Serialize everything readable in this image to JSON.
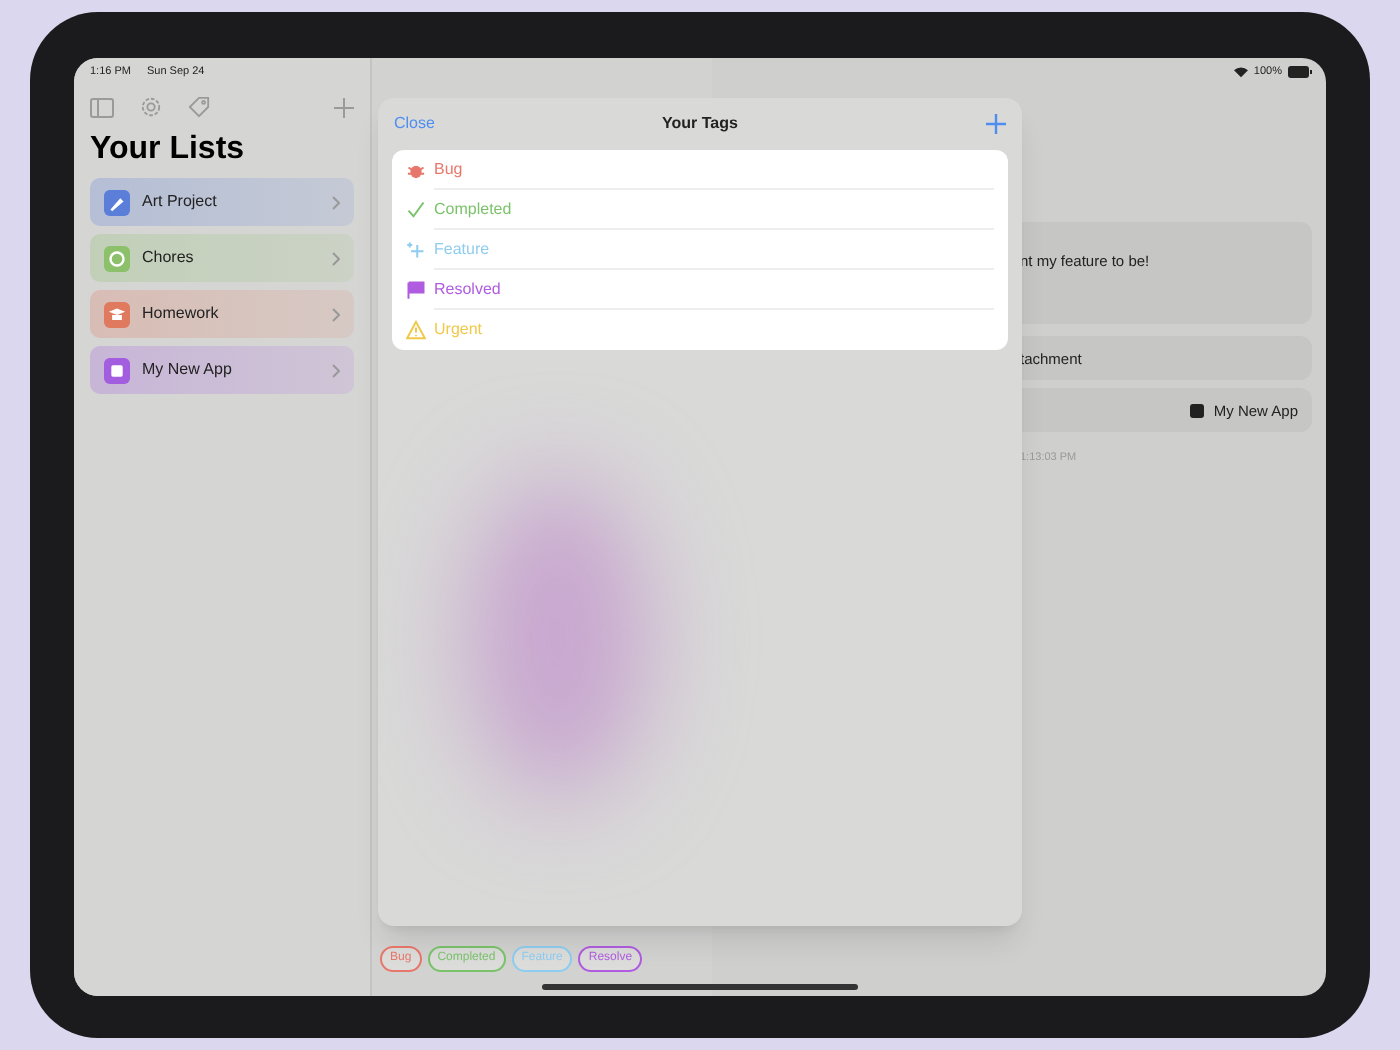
{
  "status_bar": {
    "time": "1:16 PM",
    "date": "Sun Sep 24",
    "battery": "100%"
  },
  "sidebar": {
    "title": "Your Lists",
    "items": [
      {
        "label": "Art Project",
        "color": "#5b7fd9",
        "kind": "brush"
      },
      {
        "label": "Chores",
        "color": "#8cc06a",
        "kind": "check"
      },
      {
        "label": "Homework",
        "color": "#e07a5f",
        "kind": "cap"
      },
      {
        "label": "My New App",
        "color": "#a35ee0",
        "kind": "square"
      }
    ]
  },
  "detail": {
    "description": "nt my feature to be!",
    "attachment": "tachment",
    "list": "My New App",
    "timestamp": "1:13:03 PM"
  },
  "tag_chips": [
    {
      "label": "Bug",
      "color": "#e8776b"
    },
    {
      "label": "Completed",
      "color": "#7ac36a"
    },
    {
      "label": "Feature",
      "color": "#8ecdf0"
    },
    {
      "label": "Resolve",
      "color": "#b05ce0"
    }
  ],
  "modal": {
    "close": "Close",
    "title": "Your Tags",
    "tags": [
      {
        "label": "Bug",
        "color": "#e8776b",
        "kind": "bug"
      },
      {
        "label": "Completed",
        "color": "#7ac36a",
        "kind": "check"
      },
      {
        "label": "Feature",
        "color": "#8ecdf0",
        "kind": "sparkle"
      },
      {
        "label": "Resolved",
        "color": "#b05ce0",
        "kind": "flag"
      },
      {
        "label": "Urgent",
        "color": "#f0c84a",
        "kind": "warning"
      }
    ]
  }
}
